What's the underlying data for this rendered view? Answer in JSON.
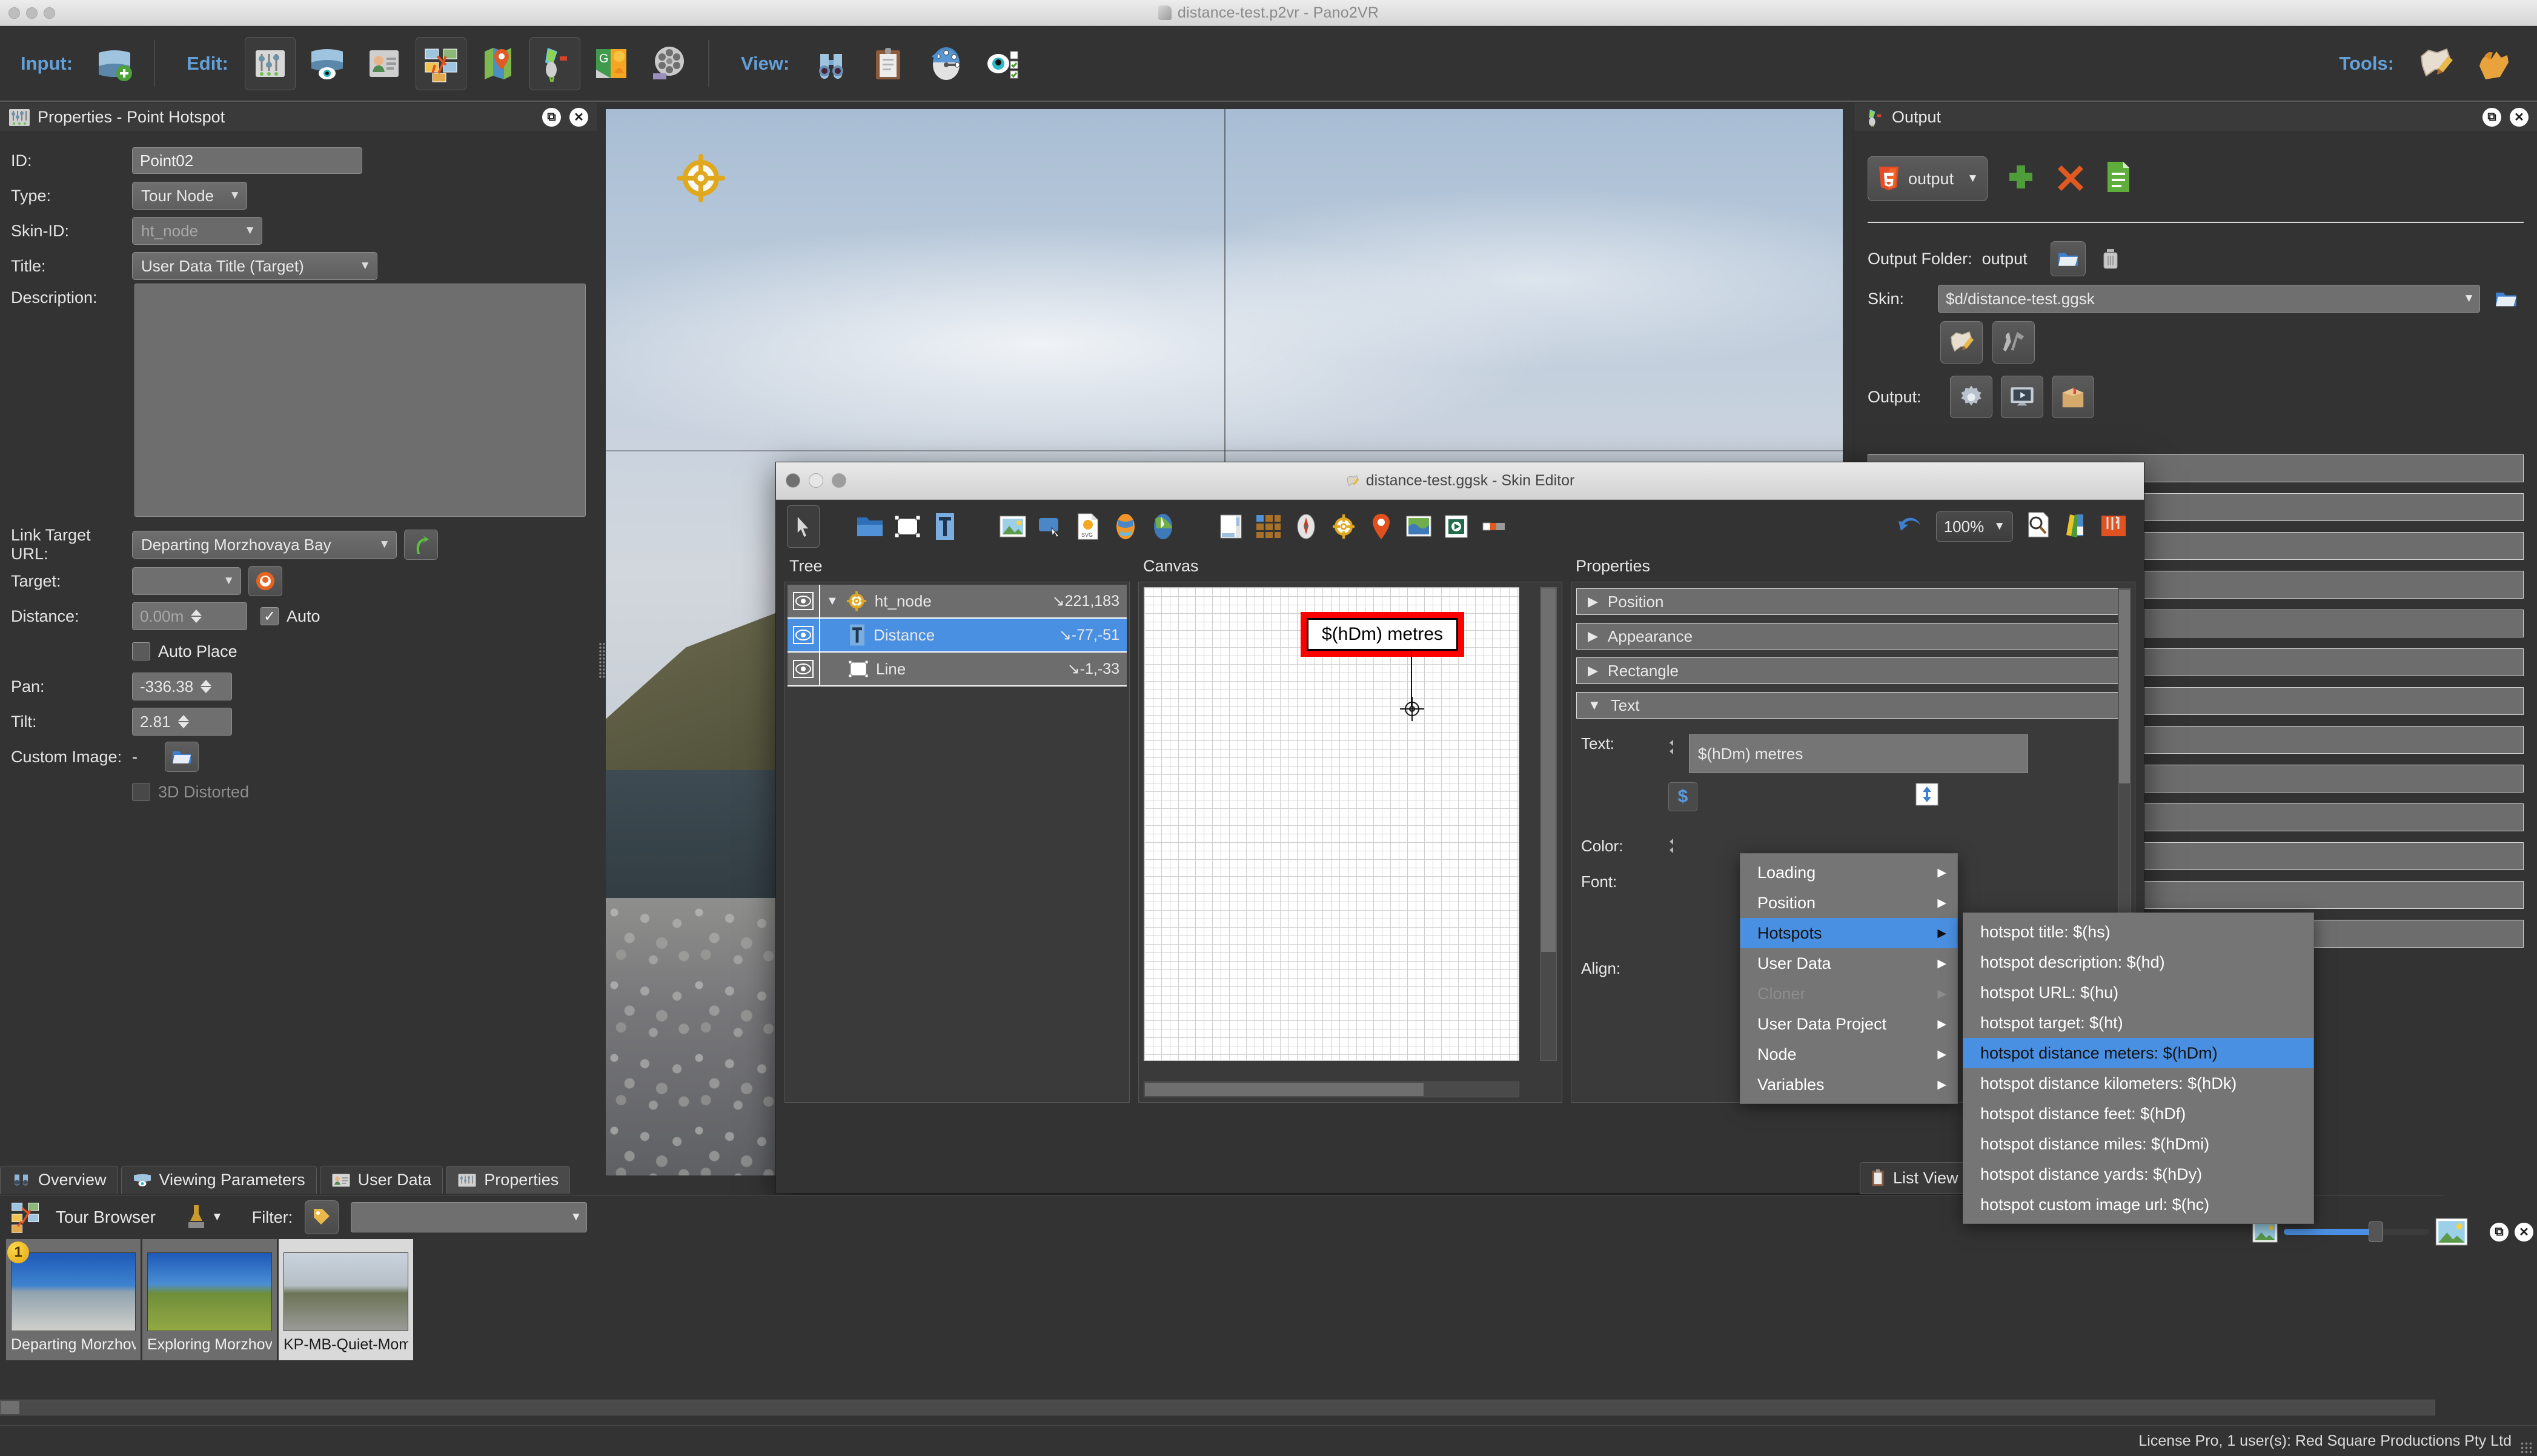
{
  "window": {
    "title": "distance-test.p2vr - Pano2VR"
  },
  "toolbar": {
    "input_label": "Input:",
    "edit_label": "Edit:",
    "view_label": "View:",
    "tools_label": "Tools:",
    "input_items": [
      {
        "name": "add-panorama",
        "icon": "panorama-plus-icon"
      }
    ],
    "edit_items": [
      {
        "name": "properties",
        "icon": "sliders-icon"
      },
      {
        "name": "viewing-parameters",
        "icon": "panorama-eye-icon"
      },
      {
        "name": "user-data",
        "icon": "id-card-icon"
      },
      {
        "name": "tour-browser",
        "icon": "tour-map-icon"
      },
      {
        "name": "map-locations",
        "icon": "map-pin-icon"
      },
      {
        "name": "output",
        "icon": "output-rocket-icon"
      },
      {
        "name": "google-poi",
        "icon": "google-streetview-icon"
      },
      {
        "name": "animation",
        "icon": "film-reel-icon"
      }
    ],
    "view_items": [
      {
        "name": "overview",
        "icon": "binoculars-icon"
      },
      {
        "name": "list-view",
        "icon": "clipboard-icon"
      },
      {
        "name": "viewing-direction",
        "icon": "compass-clock-icon"
      },
      {
        "name": "visibility",
        "icon": "eye-checklist-icon"
      }
    ],
    "tools_items": [
      {
        "name": "skin-editor",
        "icon": "skin-pencil-icon"
      },
      {
        "name": "settings",
        "icon": "hand-tool-icon"
      }
    ]
  },
  "properties_panel": {
    "title": "Properties - Point Hotspot",
    "icon": "sliders-icon",
    "restore_icon": "restore-icon",
    "close_icon": "close-icon",
    "fields": {
      "id_label": "ID:",
      "id_value": "Point02",
      "type_label": "Type:",
      "type_value": "Tour Node",
      "skin_id_label": "Skin-ID:",
      "skin_id_value": "ht_node",
      "title_label": "Title:",
      "title_value": "User Data Title (Target)",
      "description_label": "Description:",
      "description_value": "",
      "link_target_url_label": "Link Target URL:",
      "link_target_url_value": "Departing Morzhovaya Bay",
      "target_label": "Target:",
      "target_value": "",
      "distance_label": "Distance:",
      "distance_value": "0.00m",
      "auto_label": "Auto",
      "auto_checked": "✓",
      "auto_place_label": "Auto Place",
      "pan_label": "Pan:",
      "pan_value": "-336.38",
      "tilt_label": "Tilt:",
      "tilt_value": "2.81",
      "custom_image_label": "Custom Image:",
      "custom_image_value": "-",
      "distorted_label": "3D Distorted"
    }
  },
  "output_panel": {
    "title": "Output",
    "icon": "output-rocket-icon",
    "format_button": "output",
    "add_icon": "plus-icon",
    "remove_icon": "cross-icon",
    "list_icon": "document-list-icon",
    "output_folder_label": "Output Folder:",
    "output_folder_value": "output",
    "folder_icon": "folder-icon",
    "trash_icon": "trash-icon",
    "skin_label": "Skin:",
    "skin_value": "$d/distance-test.ggsk",
    "skin_edit_icon": "skin-pencil-icon",
    "skin_tools_icon": "wrench-hammer-icon",
    "output_label": "Output:",
    "output_icons": [
      "gear-icon",
      "preview-monitor-icon",
      "package-box-icon"
    ]
  },
  "skin_editor": {
    "title": "distance-test.ggsk - Skin Editor",
    "zoom": "100%",
    "tools": [
      {
        "name": "select-tool",
        "icon": "arrow-cursor-icon"
      },
      {
        "name": "add-container",
        "icon": "folder-icon"
      },
      {
        "name": "add-rectangle",
        "icon": "rectangle-icon"
      },
      {
        "name": "add-text",
        "icon": "text-icon"
      },
      {
        "name": "add-image",
        "icon": "image-icon"
      },
      {
        "name": "add-button",
        "icon": "button-icon"
      },
      {
        "name": "add-svg",
        "icon": "svg-file-icon"
      },
      {
        "name": "add-hotspot-template",
        "icon": "globe-orange-icon"
      },
      {
        "name": "add-map",
        "icon": "map-globe-icon"
      },
      {
        "name": "add-scrollarea",
        "icon": "scroll-area-icon"
      },
      {
        "name": "add-thumbnail-grid",
        "icon": "grid-icon"
      },
      {
        "name": "add-compass",
        "icon": "compass-icon"
      },
      {
        "name": "add-node-marker",
        "icon": "node-target-icon"
      },
      {
        "name": "add-map-pin",
        "icon": "map-pin-icon"
      },
      {
        "name": "add-world-map",
        "icon": "world-map-icon"
      },
      {
        "name": "add-video",
        "icon": "video-icon"
      },
      {
        "name": "add-timeline",
        "icon": "timeline-icon"
      },
      {
        "name": "undo",
        "icon": "undo-icon"
      },
      {
        "name": "preview",
        "icon": "magnifier-page-icon"
      },
      {
        "name": "colors",
        "icon": "color-palette-icon"
      },
      {
        "name": "toolbox",
        "icon": "toolbox-icon"
      }
    ],
    "tree_header": "Tree",
    "canvas_header": "Canvas",
    "properties_header": "Properties",
    "tree_rows": [
      {
        "name": "ht_node",
        "coords": "↘221,183",
        "icon": "node-target-icon",
        "selected": false,
        "expanded": "▼",
        "indent": 0
      },
      {
        "name": "Distance",
        "coords": "↘-77,-51",
        "icon": "text-icon",
        "selected": true,
        "expanded": "",
        "indent": 1
      },
      {
        "name": "Line",
        "coords": "↘-1,-33",
        "icon": "rectangle-icon",
        "selected": false,
        "expanded": "",
        "indent": 1
      }
    ],
    "canvas_element_text": "$(hDm) metres",
    "accordions": [
      {
        "label": "Position",
        "open": false,
        "arrow": "▶"
      },
      {
        "label": "Appearance",
        "open": false,
        "arrow": "▶"
      },
      {
        "label": "Rectangle",
        "open": false,
        "arrow": "▶"
      },
      {
        "label": "Text",
        "open": true,
        "arrow": "▼"
      }
    ],
    "text_label": "Text:",
    "text_value": "$(hDm) metres",
    "color_label": "Color:",
    "font_label": "Font:",
    "align_label": "Align:",
    "dollar_button": "$",
    "link_icon": "link-arrows-icon"
  },
  "context_menu": {
    "items": [
      {
        "label": "Loading",
        "submenu": true,
        "selected": false,
        "disabled": false
      },
      {
        "label": "Position",
        "submenu": true,
        "selected": false,
        "disabled": false
      },
      {
        "label": "Hotspots",
        "submenu": true,
        "selected": true,
        "disabled": false
      },
      {
        "label": "User Data",
        "submenu": true,
        "selected": false,
        "disabled": false
      },
      {
        "label": "Cloner",
        "submenu": true,
        "selected": false,
        "disabled": true
      },
      {
        "label": "User Data Project",
        "submenu": true,
        "selected": false,
        "disabled": false
      },
      {
        "label": "Node",
        "submenu": true,
        "selected": false,
        "disabled": false
      },
      {
        "label": "Variables",
        "submenu": true,
        "selected": false,
        "disabled": false
      }
    ],
    "submenu_items": [
      {
        "label": "hotspot title: $(hs)",
        "selected": false
      },
      {
        "label": "hotspot description: $(hd)",
        "selected": false
      },
      {
        "label": "hotspot URL: $(hu)",
        "selected": false
      },
      {
        "label": "hotspot target: $(ht)",
        "selected": false
      },
      {
        "label": "hotspot distance meters: $(hDm)",
        "selected": true
      },
      {
        "label": "hotspot distance kilometers: $(hDk)",
        "selected": false
      },
      {
        "label": "hotspot distance feet: $(hDf)",
        "selected": false
      },
      {
        "label": "hotspot distance miles: $(hDmi)",
        "selected": false
      },
      {
        "label": "hotspot distance yards: $(hDy)",
        "selected": false
      },
      {
        "label": "hotspot custom image url: $(hc)",
        "selected": false
      }
    ]
  },
  "bottom_tabs": [
    {
      "label": "Overview",
      "icon": "binoculars-icon",
      "active": false
    },
    {
      "label": "Viewing Parameters",
      "icon": "panorama-eye-icon",
      "active": false
    },
    {
      "label": "User Data",
      "icon": "id-card-icon",
      "active": false
    },
    {
      "label": "Properties",
      "icon": "sliders-icon",
      "active": true
    }
  ],
  "tour_browser": {
    "title": "Tour Browser",
    "stamp_icon": "stamp-icon",
    "filter_label": "Filter:",
    "filter_icon": "tag-pencil-icon",
    "filter_value": "",
    "thumbs": [
      {
        "label": "Departing Morzhovaya ...",
        "badge": "1",
        "selected": false
      },
      {
        "label": "Exploring Morzhovaya ...",
        "badge": "",
        "selected": false
      },
      {
        "label": "KP-MB-Quiet-Moment",
        "badge": "",
        "selected": true
      }
    ]
  },
  "list_view": {
    "label": "List View",
    "icon": "clipboard-icon"
  },
  "status_bar": {
    "text": "License Pro, 1 user(s): Red Square Productions Pty Ltd"
  },
  "colors": {
    "accent_blue": "#4a90e2",
    "label_blue": "#63a0d8",
    "panel_bg": "#333333",
    "field_bg": "#6f6f6f",
    "selection_red": "#ff0000",
    "hotspot_gold": "#e0a81f"
  }
}
